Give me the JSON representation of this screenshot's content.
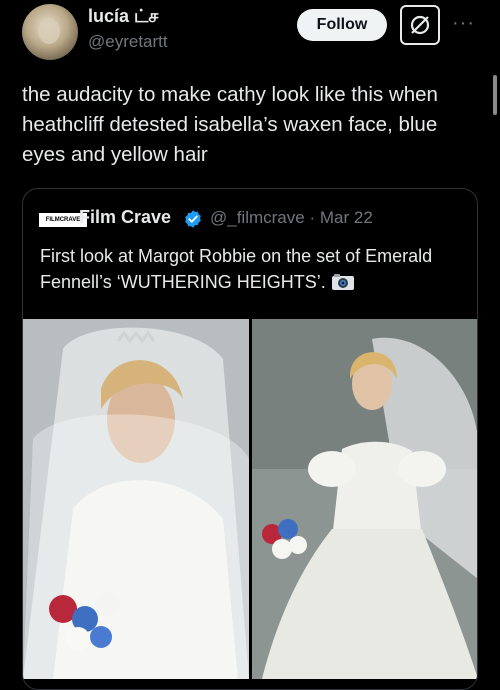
{
  "author": {
    "name": "lucía ட்ச",
    "handle": "@eyretartt"
  },
  "actions": {
    "follow_label": "Follow",
    "more_label": "···"
  },
  "tweet": {
    "text": "the audacity to make cathy look like this when heathcliff detested isabella’s waxen face, blue eyes and yellow hair"
  },
  "quoted": {
    "logo_text": "FILMCRAVE",
    "name": "Film Crave",
    "handle": "@_filmcrave",
    "separator": "·",
    "date": "Mar 22",
    "text": "First look at Margot Robbie on the set of Emerald Fennell’s ‘WUTHERING HEIGHTS’.",
    "verified_color": "#1d9bf0"
  },
  "colors": {
    "background": "#000000",
    "text": "#e7e9ea",
    "secondary": "#71767b",
    "border": "#2f3336"
  },
  "icons": {
    "grok": "grok-slash-icon",
    "verified": "verified-badge-icon",
    "camera": "camera-emoji-icon"
  }
}
